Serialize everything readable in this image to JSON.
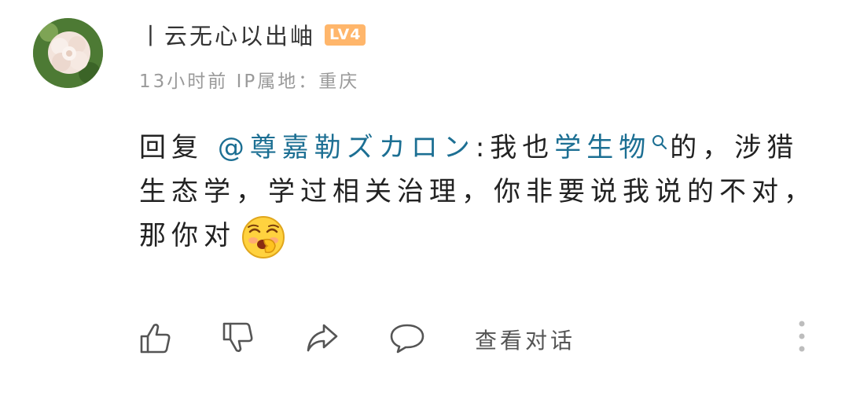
{
  "comment": {
    "username": "丨云无心以出岫",
    "level": "LV4",
    "time_location": "13小时前 IP属地：重庆",
    "reply_prefix": "回复",
    "mention": "@尊嘉勒ズカロン",
    "text_part1": ":我也",
    "keyword": "学生物",
    "text_part2": "的，涉猎生态学，学过相关治理，你非要说我说的不对，那你对",
    "emoji": "laughing-cover-mouth-emoji"
  },
  "actions": {
    "view_thread": "查看对话",
    "icons": [
      "thumbs-up-icon",
      "thumbs-down-icon",
      "share-icon",
      "comment-icon",
      "more-icon"
    ]
  },
  "colors": {
    "link": "#1c6f93",
    "badge": "#ffb66b",
    "meta": "#9a9a9a"
  }
}
